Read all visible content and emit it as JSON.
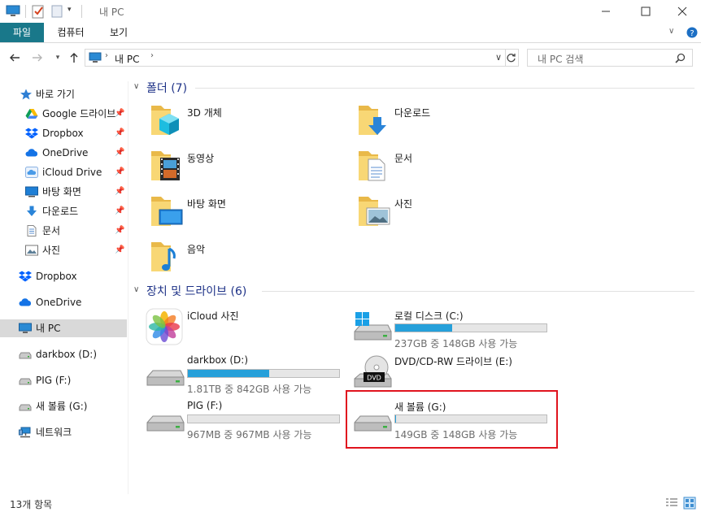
{
  "window": {
    "title": "내 PC"
  },
  "ribbon": {
    "tabs": [
      "파일",
      "컴퓨터",
      "보기"
    ]
  },
  "address": {
    "path": [
      "내 PC"
    ]
  },
  "search": {
    "placeholder": "내 PC 검색"
  },
  "sidebar": {
    "items": [
      {
        "label": "바로 가기",
        "icon": "star-icon",
        "pinned": false
      },
      {
        "label": "Google 드라이브",
        "icon": "google-drive-icon",
        "pinned": true
      },
      {
        "label": "Dropbox",
        "icon": "dropbox-icon",
        "pinned": true
      },
      {
        "label": "OneDrive",
        "icon": "onedrive-icon",
        "pinned": true
      },
      {
        "label": "iCloud Drive",
        "icon": "icloud-icon",
        "pinned": true
      },
      {
        "label": "바탕 화면",
        "icon": "desktop-icon",
        "pinned": true
      },
      {
        "label": "다운로드",
        "icon": "download-icon",
        "pinned": true
      },
      {
        "label": "문서",
        "icon": "document-icon",
        "pinned": true
      },
      {
        "label": "사진",
        "icon": "picture-icon",
        "pinned": true
      },
      {
        "label": "Dropbox",
        "icon": "dropbox-icon",
        "pinned": false
      },
      {
        "label": "OneDrive",
        "icon": "onedrive-icon",
        "pinned": false
      },
      {
        "label": "내 PC",
        "icon": "computer-icon",
        "pinned": false,
        "selected": true
      },
      {
        "label": "darkbox (D:)",
        "icon": "drive-icon",
        "pinned": false
      },
      {
        "label": "PIG (F:)",
        "icon": "drive-icon",
        "pinned": false
      },
      {
        "label": "새 볼륨 (G:)",
        "icon": "drive-icon",
        "pinned": false
      },
      {
        "label": "네트워크",
        "icon": "network-icon",
        "pinned": false
      }
    ]
  },
  "folders": {
    "header": "폴더 (7)",
    "items": [
      {
        "label": "3D 개체",
        "icon": "3d-objects-folder-icon"
      },
      {
        "label": "다운로드",
        "icon": "downloads-folder-icon"
      },
      {
        "label": "동영상",
        "icon": "videos-folder-icon"
      },
      {
        "label": "문서",
        "icon": "documents-folder-icon"
      },
      {
        "label": "바탕 화면",
        "icon": "desktop-folder-icon"
      },
      {
        "label": "사진",
        "icon": "pictures-folder-icon"
      },
      {
        "label": "음악",
        "icon": "music-folder-icon"
      }
    ]
  },
  "devices": {
    "header": "장치 및 드라이브 (6)",
    "items": [
      {
        "label": "iCloud 사진",
        "icon": "icloud-photos-icon",
        "has_bar": false
      },
      {
        "label": "로컬 디스크 (C:)",
        "icon": "windows-drive-icon",
        "has_bar": true,
        "used_fraction": 0.375,
        "space": "237GB 중 148GB 사용 가능"
      },
      {
        "label": "darkbox (D:)",
        "icon": "drive-icon",
        "has_bar": true,
        "used_fraction": 0.54,
        "space": "1.81TB 중 842GB 사용 가능"
      },
      {
        "label": "DVD/CD-RW 드라이브 (E:)",
        "icon": "dvd-drive-icon",
        "has_bar": false
      },
      {
        "label": "PIG (F:)",
        "icon": "drive-icon",
        "has_bar": true,
        "used_fraction": 0.0,
        "space": "967MB 중 967MB 사용 가능"
      },
      {
        "label": "새 볼륨 (G:)",
        "icon": "drive-icon",
        "has_bar": true,
        "used_fraction": 0.005,
        "space": "149GB 중 148GB 사용 가능"
      }
    ]
  },
  "status": {
    "count": "13개 항목"
  },
  "colors": {
    "accent": "#19788a",
    "bar_fill": "#26a0da",
    "group_title": "#1e3287",
    "highlight": "#e0141e"
  }
}
